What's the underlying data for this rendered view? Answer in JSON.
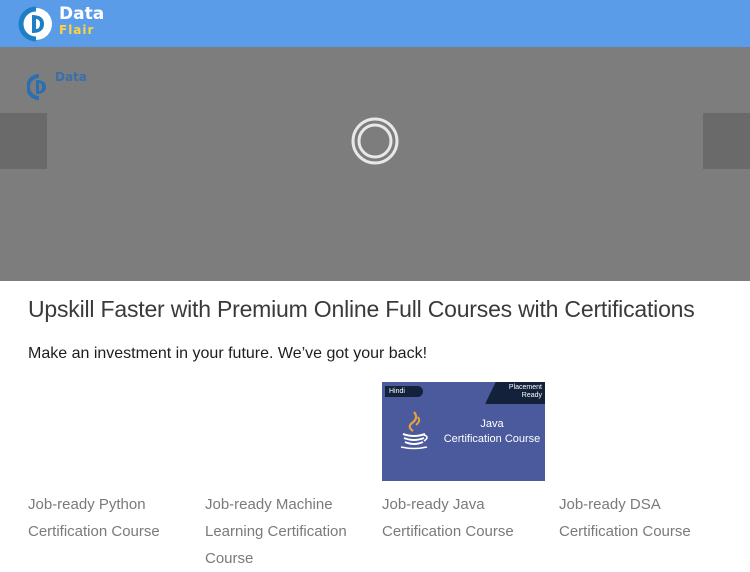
{
  "header": {
    "logo_line1": "Data",
    "logo_line2": "Flair"
  },
  "slider": {
    "logo_text": "Data",
    "prev_icon": "chevron-left-icon",
    "next_icon": "chevron-right-icon",
    "loading_icon": "loading-spinner-icon"
  },
  "main": {
    "title": "Upskill Faster with Premium Online Full Courses with Certifications",
    "subtitle": "Make an investment in your future. We’ve got your back!"
  },
  "courses": [
    {
      "title": "Job-ready Python Certification Course",
      "has_image": false
    },
    {
      "title": "Job-ready Machine Learning Certification Course",
      "has_image": false
    },
    {
      "title": "Job-ready Java Certification Course",
      "has_image": true,
      "thumb": {
        "tag": "Hindi",
        "badge_line1": "Placement",
        "badge_line2": "Ready",
        "title_line1": "Java",
        "title_line2": "Certification Course",
        "icon": "java-cup-icon"
      }
    },
    {
      "title": "Job-ready DSA Certification Course",
      "has_image": false
    }
  ],
  "colors": {
    "header_bg": "#5a9ce8",
    "overlay_bg": "#7d7d7d",
    "course_title": "#7a7a7a",
    "logo_accent": "#ffd23e"
  }
}
